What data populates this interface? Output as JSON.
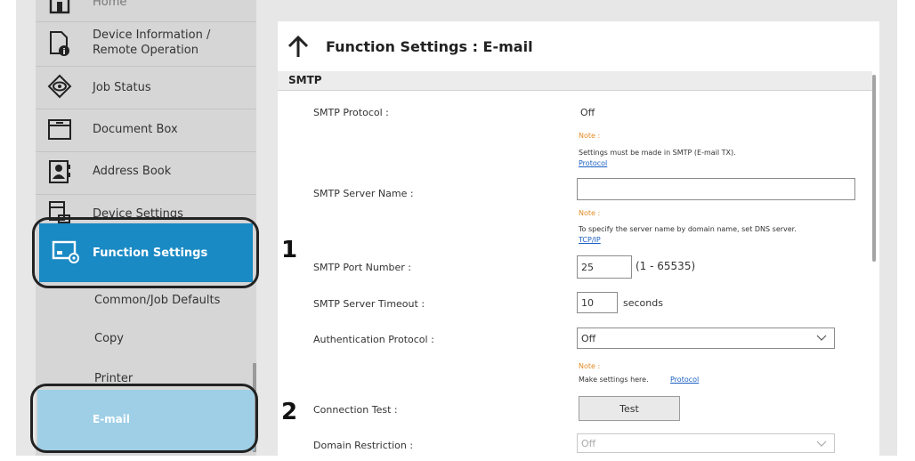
{
  "sidebar": {
    "items": [
      {
        "label": "Home",
        "icon": "home-icon"
      },
      {
        "label": "Device Information /",
        "label2": "Remote Operation",
        "icon": "device-info-icon"
      },
      {
        "label": "Job Status",
        "icon": "job-status-icon"
      },
      {
        "label": "Document Box",
        "icon": "document-box-icon"
      },
      {
        "label": "Address Book",
        "icon": "address-book-icon"
      },
      {
        "label": "Device Settings",
        "icon": "device-settings-icon"
      },
      {
        "label": "Function Settings",
        "icon": "function-settings-icon"
      },
      {
        "label": "Common/Job Defaults"
      },
      {
        "label": "Copy"
      },
      {
        "label": "Printer"
      },
      {
        "label": "E-mail"
      }
    ]
  },
  "page": {
    "title": "Function Settings : E-mail",
    "section": "SMTP"
  },
  "rows": {
    "smtp_protocol": {
      "label": "SMTP Protocol :",
      "value": "Off"
    },
    "note1": {
      "title": "Note :",
      "text": "Settings must be made in SMTP (E-mail TX).",
      "link": "Protocol"
    },
    "smtp_server_name": {
      "label": "SMTP Server Name :",
      "value": ""
    },
    "note2": {
      "title": "Note :",
      "text": "To specify the server name by domain name, set DNS server.",
      "link": "TCP/IP"
    },
    "smtp_port": {
      "label": "SMTP Port Number :",
      "value": "25",
      "range": "(1 - 65535)"
    },
    "smtp_timeout": {
      "label": "SMTP Server Timeout :",
      "value": "10",
      "unit": "seconds"
    },
    "auth_protocol": {
      "label": "Authentication Protocol :",
      "value": "Off"
    },
    "note3": {
      "title": "Note :",
      "text": "Make settings here.",
      "link": "Protocol"
    },
    "connection_test": {
      "label": "Connection Test :",
      "button": "Test"
    },
    "domain_restriction": {
      "label": "Domain Restriction :",
      "value": "Off"
    }
  },
  "steps": {
    "one": "1",
    "two": "2"
  },
  "colors": {
    "accent": "#1a8ac4",
    "email_highlight": "#9fcfe6",
    "note_orange": "#e28b25",
    "link_blue": "#1a5fc0"
  }
}
